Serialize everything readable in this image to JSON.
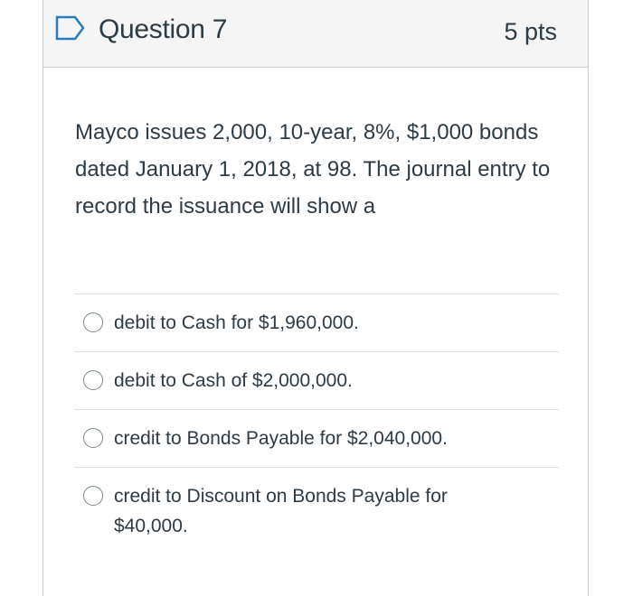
{
  "question": {
    "title": "Question 7",
    "points": "5 pts",
    "text": "Mayco issues 2,000, 10-year, 8%, $1,000 bonds dated January 1, 2018, at 98. The journal entry to record the issuance will show a",
    "flag_icon": "flag-outline-icon",
    "flag_color": "#2b7abc"
  },
  "answers": [
    {
      "label": "debit to Cash for $1,960,000."
    },
    {
      "label": "debit to Cash of $2,000,000."
    },
    {
      "label": "credit to Bonds Payable for $2,040,000."
    },
    {
      "label": "credit to Discount on Bonds Payable for $40,000."
    }
  ]
}
